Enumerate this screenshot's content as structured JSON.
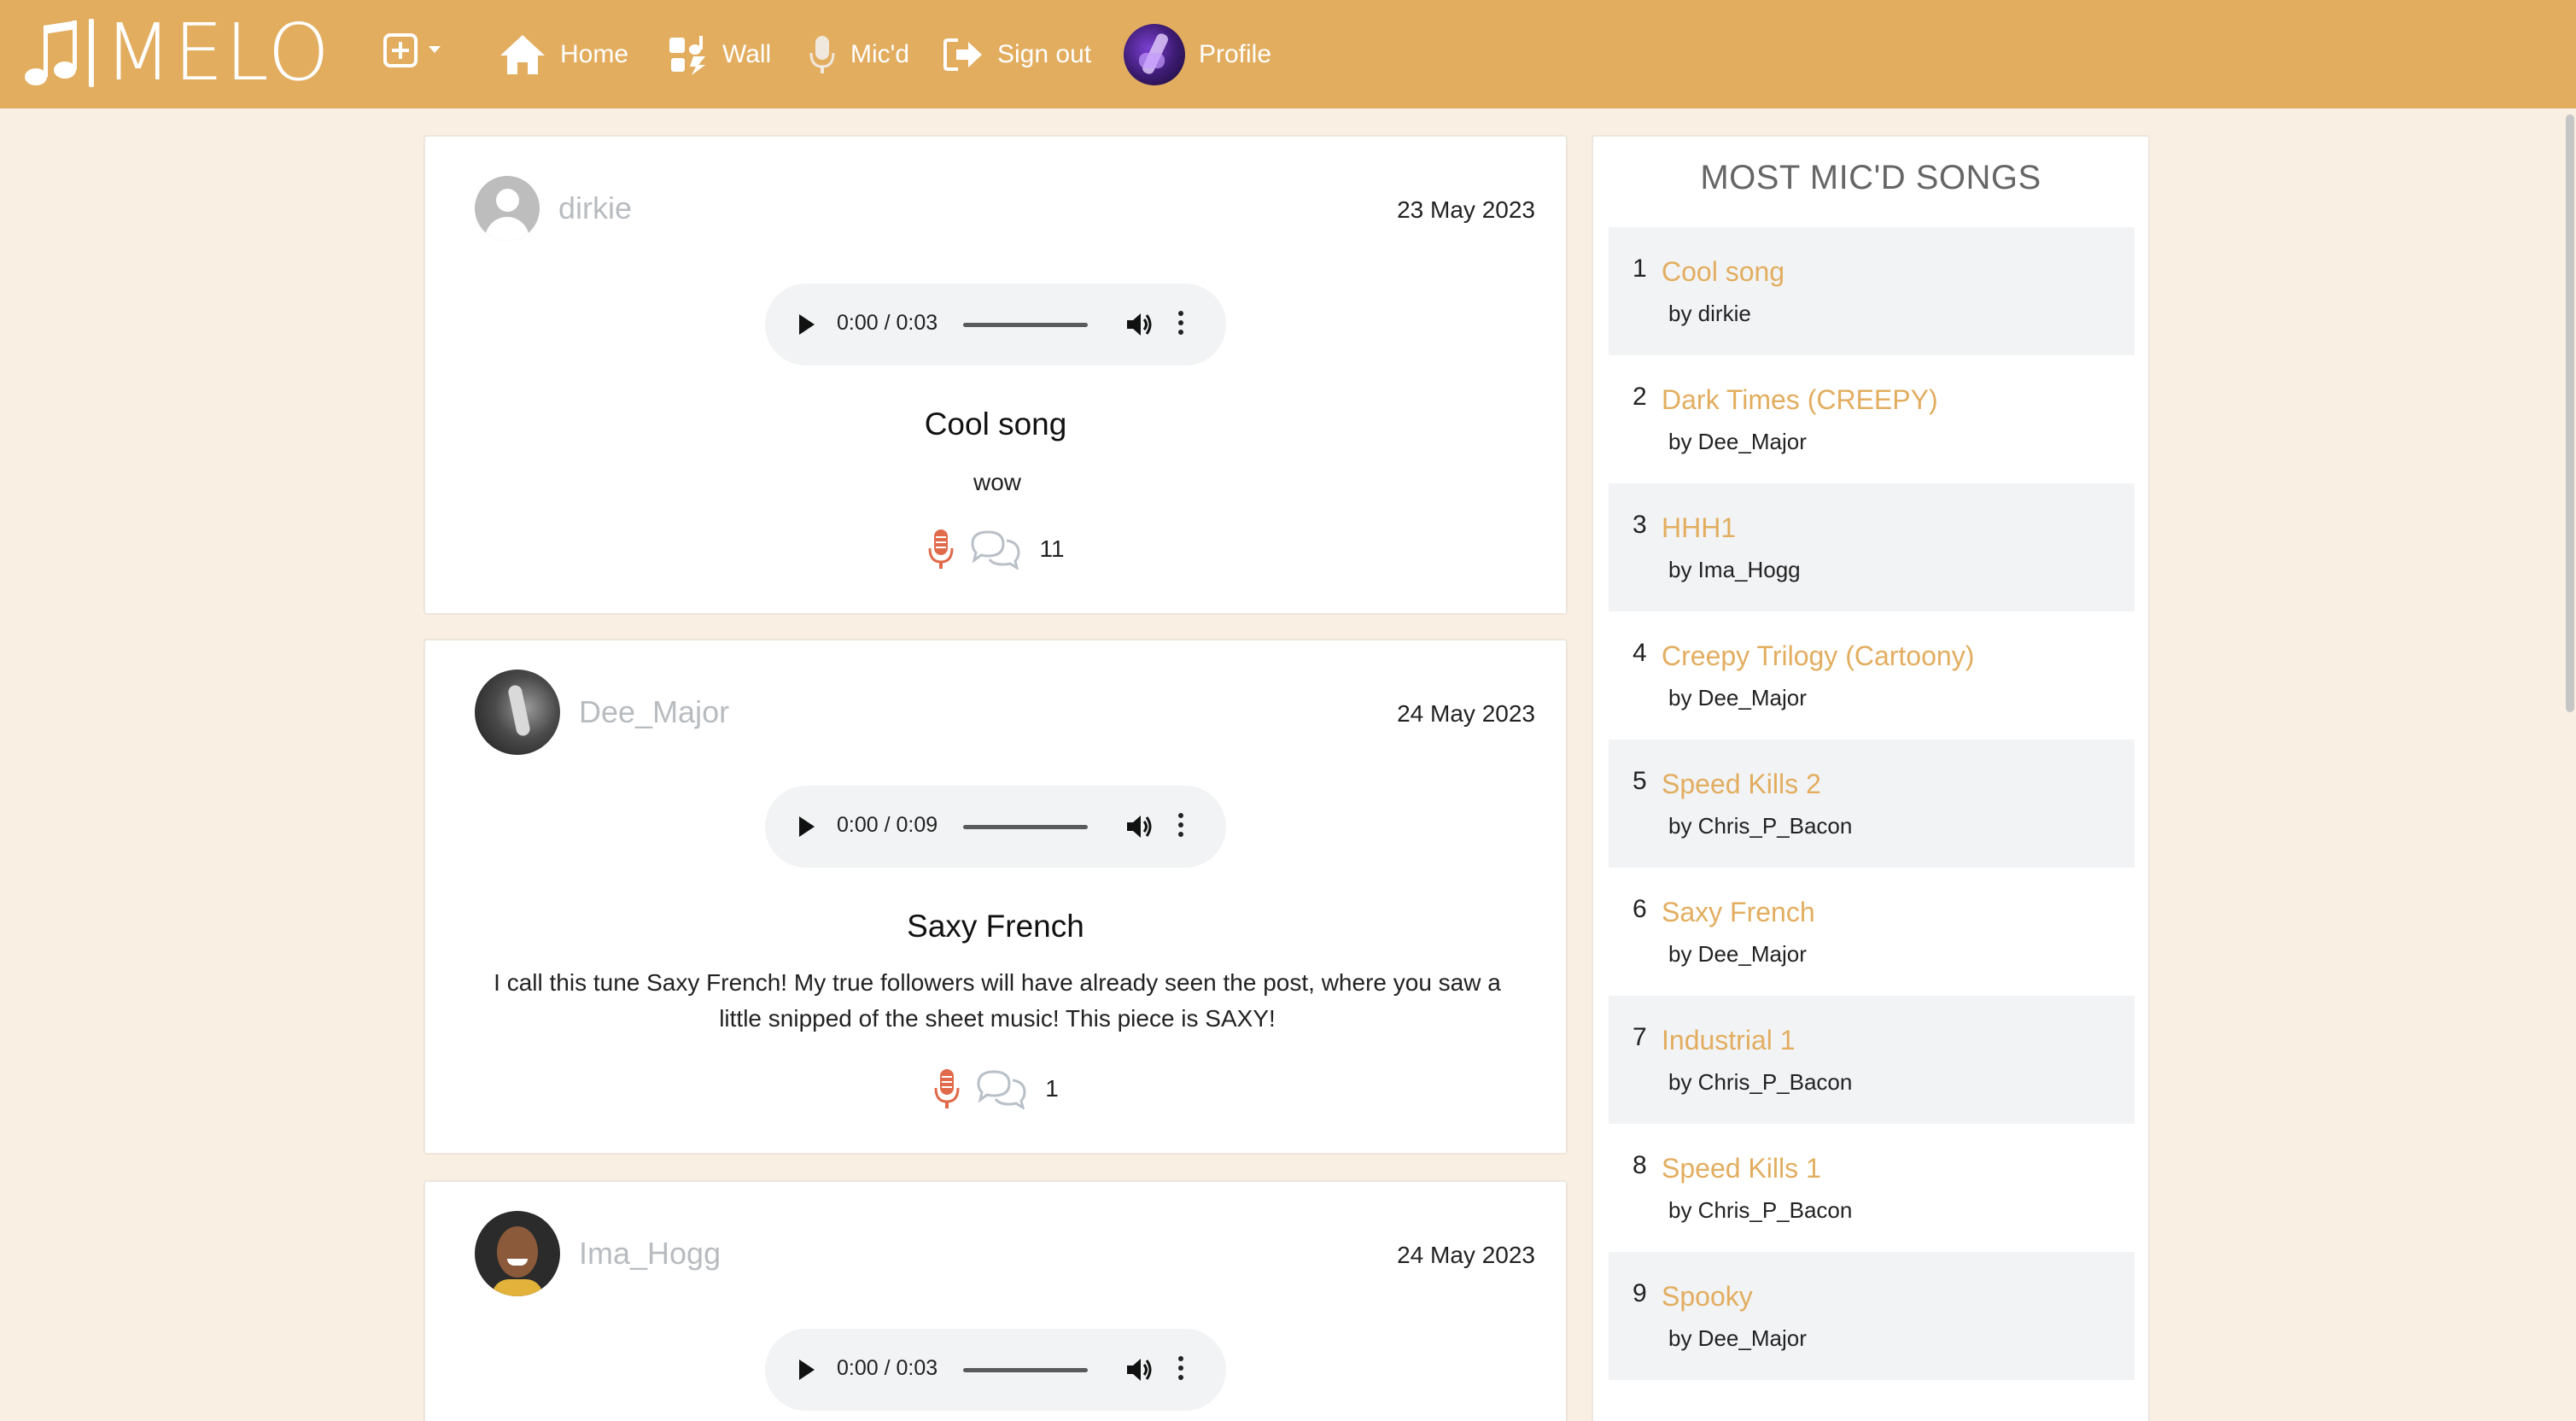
{
  "navbar": {
    "brand": "MELO",
    "home_label": "Home",
    "wall_label": "Wall",
    "micd_label": "Mic'd",
    "signout_label": "Sign out",
    "profile_label": "Profile",
    "color": "#e2ad5f"
  },
  "posts": [
    {
      "author": "dirkie",
      "date": "23 May 2023",
      "audio_time": "0:00 / 0:03",
      "title": "Cool song",
      "description": "wow",
      "comment_count": "11"
    },
    {
      "author": "Dee_Major",
      "date": "24 May 2023",
      "audio_time": "0:00 / 0:09",
      "title": "Saxy French",
      "description": "I call this tune Saxy French! My true followers will have already seen the post, where you saw a little snipped of the sheet music! This piece is SAXY!",
      "comment_count": "1"
    },
    {
      "author": "Ima_Hogg",
      "date": "24 May 2023",
      "audio_time": "0:00 / 0:03"
    }
  ],
  "sidebar": {
    "title": "MOST MIC'D SONGS",
    "items": [
      {
        "rank": "1",
        "title": "Cool song",
        "by": "by dirkie"
      },
      {
        "rank": "2",
        "title": "Dark Times (CREEPY)",
        "by": "by Dee_Major"
      },
      {
        "rank": "3",
        "title": "HHH1",
        "by": "by Ima_Hogg"
      },
      {
        "rank": "4",
        "title": "Creepy Trilogy (Cartoony)",
        "by": "by Dee_Major"
      },
      {
        "rank": "5",
        "title": "Speed Kills 2",
        "by": "by Chris_P_Bacon"
      },
      {
        "rank": "6",
        "title": "Saxy French",
        "by": "by Dee_Major"
      },
      {
        "rank": "7",
        "title": "Industrial 1",
        "by": "by Chris_P_Bacon"
      },
      {
        "rank": "8",
        "title": "Speed Kills 1",
        "by": "by Chris_P_Bacon"
      },
      {
        "rank": "9",
        "title": "Spooky",
        "by": "by Dee_Major"
      }
    ]
  },
  "colors": {
    "accent": "#e2ad5f",
    "mic_active": "#e06a4a",
    "background": "#f9efe3"
  }
}
